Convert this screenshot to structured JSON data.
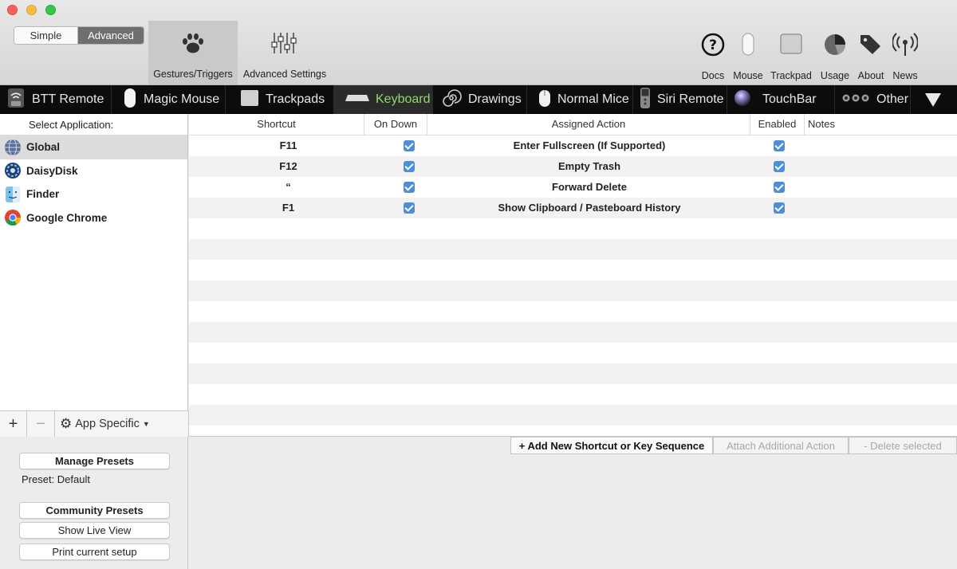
{
  "toolbar": {
    "segment": {
      "simple": "Simple",
      "advanced": "Advanced"
    },
    "tabs": [
      {
        "label": "Gestures/Triggers",
        "icon": "paw-icon"
      },
      {
        "label": "Advanced Settings",
        "icon": "sliders-icon"
      }
    ],
    "right_items": [
      {
        "label": "Docs",
        "icon": "help-icon"
      },
      {
        "label": "Mouse",
        "icon": "mouse-icon"
      },
      {
        "label": "Trackpad",
        "icon": "trackpad-icon"
      },
      {
        "label": "Usage",
        "icon": "pie-chart-icon"
      },
      {
        "label": "About",
        "icon": "tags-icon"
      },
      {
        "label": "News",
        "icon": "antenna-icon"
      }
    ]
  },
  "devices": [
    {
      "label": "BTT Remote",
      "icon": "remote-icon"
    },
    {
      "label": "Magic Mouse",
      "icon": "magic-mouse-icon"
    },
    {
      "label": "Trackpads",
      "icon": "trackpad-icon"
    },
    {
      "label": "Keyboard",
      "icon": "keyboard-icon",
      "active": true
    },
    {
      "label": "Drawings",
      "icon": "spiral-icon"
    },
    {
      "label": "Normal Mice",
      "icon": "mouse-icon"
    },
    {
      "label": "Siri Remote",
      "icon": "siri-remote-icon"
    },
    {
      "label": "TouchBar",
      "icon": "touchbar-icon"
    },
    {
      "label": "Other",
      "icon": "dots-icon"
    }
  ],
  "apps": {
    "header": "Select Application:",
    "items": [
      {
        "label": "Global",
        "icon": "globe-icon",
        "selected": true
      },
      {
        "label": "DaisyDisk",
        "icon": "daisydisk-icon"
      },
      {
        "label": "Finder",
        "icon": "finder-icon"
      },
      {
        "label": "Google Chrome",
        "icon": "chrome-icon"
      }
    ],
    "app_specific": "App Specific"
  },
  "table": {
    "columns": [
      "Shortcut",
      "On Down",
      "Assigned Action",
      "Enabled",
      "Notes"
    ],
    "rows": [
      {
        "shortcut": "F11",
        "on_down": true,
        "action": "Enter Fullscreen (If Supported)",
        "enabled": true,
        "notes": ""
      },
      {
        "shortcut": "F12",
        "on_down": true,
        "action": "Empty Trash",
        "enabled": true,
        "notes": ""
      },
      {
        "shortcut": "“",
        "on_down": true,
        "action": "Forward Delete",
        "enabled": true,
        "notes": ""
      },
      {
        "shortcut": "F1",
        "on_down": true,
        "action": "Show Clipboard / Pasteboard History",
        "enabled": true,
        "notes": ""
      }
    ]
  },
  "actions": {
    "add": "+ Add New Shortcut or Key Sequence",
    "attach": "Attach Additional Action",
    "delete": "- Delete selected"
  },
  "presets": {
    "manage": "Manage Presets",
    "current": "Preset: Default",
    "community": "Community Presets",
    "live": "Show Live View",
    "print": "Print current setup"
  },
  "colors": {
    "accent_check": "#4d8ed9",
    "active_device": "#8fd96b"
  }
}
